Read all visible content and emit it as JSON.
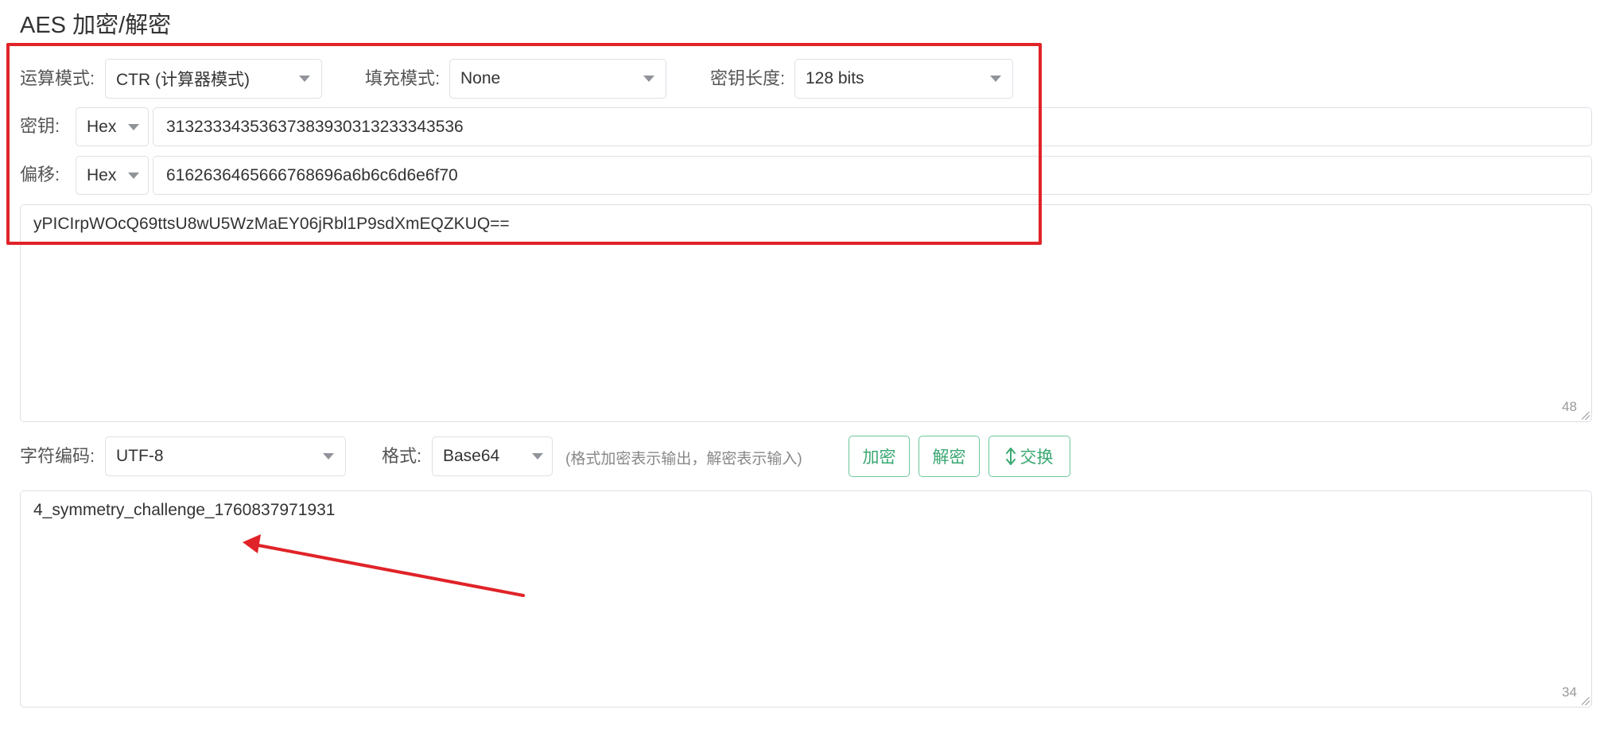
{
  "page": {
    "title": "AES 加密/解密"
  },
  "settings": {
    "mode_label": "运算模式:",
    "mode_value": "CTR (计算器模式)",
    "padding_label": "填充模式:",
    "padding_value": "None",
    "keylen_label": "密钥长度:",
    "keylen_value": "128 bits"
  },
  "key": {
    "label": "密钥:",
    "format": "Hex",
    "value": "31323334353637383930313233343536"
  },
  "iv": {
    "label": "偏移:",
    "format": "Hex",
    "value": "6162636465666768696a6b6c6d6e6f70"
  },
  "input": {
    "value": "yPICIrpWOcQ69ttsU8wU5WzMaEY06jRbl1P9sdXmEQZKUQ==",
    "count": "48"
  },
  "controls": {
    "charset_label": "字符编码:",
    "charset_value": "UTF-8",
    "format_label": "格式:",
    "format_value": "Base64",
    "hint": "(格式加密表示输出，解密表示输入)",
    "encrypt_label": "加密",
    "decrypt_label": "解密",
    "swap_label": "交换"
  },
  "output": {
    "value": "4_symmetry_challenge_1760837971931",
    "count": "34"
  },
  "colors": {
    "accent": "#3aa872",
    "annotation": "#e02328"
  },
  "icons": {
    "dropdown": "caret-down",
    "swap": "up-down-arrow"
  }
}
